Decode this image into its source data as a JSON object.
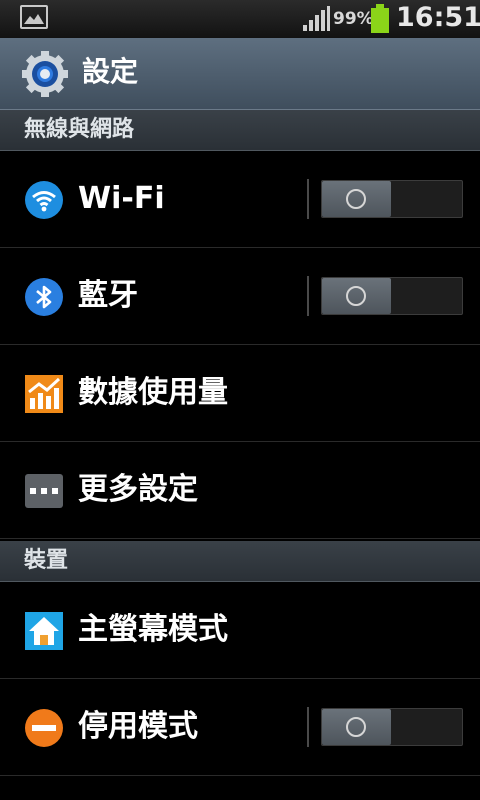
{
  "status_bar": {
    "battery_percent": "99%",
    "time": "16:51",
    "icons": [
      "gallery-notification-icon",
      "signal-icon",
      "battery-icon"
    ],
    "battery_color": "#8bd419"
  },
  "header": {
    "title": "設定",
    "icon": "gear-icon"
  },
  "sections": [
    {
      "title": "無線與網路",
      "items": [
        {
          "label": "Wi-Fi",
          "icon": "wifi-icon",
          "toggle": "off"
        },
        {
          "label": "藍牙",
          "icon": "bluetooth-icon",
          "toggle": "off"
        },
        {
          "label": "數據使用量",
          "icon": "data-usage-icon"
        },
        {
          "label": "更多設定",
          "icon": "more-settings-icon"
        }
      ]
    },
    {
      "title": "裝置",
      "items": [
        {
          "label": "主螢幕模式",
          "icon": "home-screen-mode-icon"
        },
        {
          "label": "停用模式",
          "icon": "blocking-mode-icon",
          "toggle": "off"
        }
      ]
    }
  ],
  "colors": {
    "title_bar": "#4f5f6f",
    "section_header": "#32393f",
    "background": "#000000",
    "wifi_blue": "#1e8ee0",
    "bluetooth_blue": "#2a7fe0",
    "data_orange": "#f08a18",
    "blocking_orange": "#f07a1a"
  }
}
